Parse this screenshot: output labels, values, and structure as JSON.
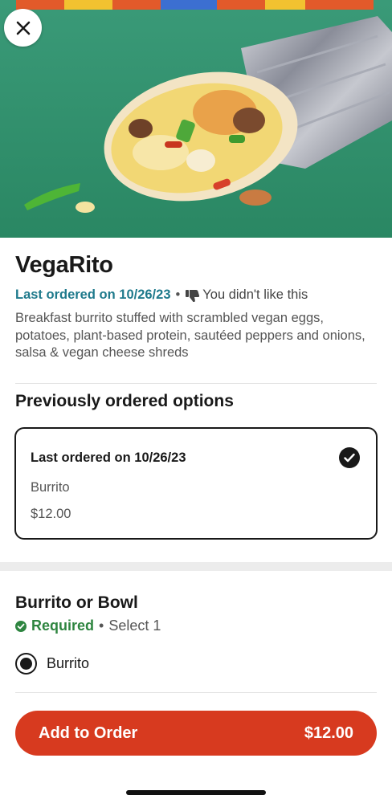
{
  "product": {
    "name": "VegaRito",
    "last_ordered": "Last ordered on 10/26/23",
    "separator": "•",
    "feedback": "You didn't like this",
    "description": "Breakfast burrito stuffed with scrambled vegan eggs, potatoes, plant-based protein, sautéed peppers and onions, salsa & vegan cheese shreds"
  },
  "previous_options": {
    "title": "Previously ordered options",
    "card": {
      "title": "Last ordered on 10/26/23",
      "item": "Burrito",
      "price": "$12.00",
      "selected": true
    }
  },
  "burrito_or_bowl": {
    "title": "Burrito or Bowl",
    "required_label": "Required",
    "separator": "•",
    "select_label": "Select 1",
    "options": [
      {
        "label": "Burrito",
        "selected": true
      }
    ]
  },
  "footer": {
    "add_label": "Add to Order",
    "price": "$12.00"
  },
  "colors": {
    "accent_red": "#d73a1f",
    "teal_text": "#1f7a8c",
    "required_green": "#2e8540"
  },
  "icons": {
    "close": "close-icon",
    "dislike": "thumbs-down-icon",
    "check": "check-circle-icon",
    "required": "check-circle-icon",
    "radio": "radio-selected-icon"
  }
}
